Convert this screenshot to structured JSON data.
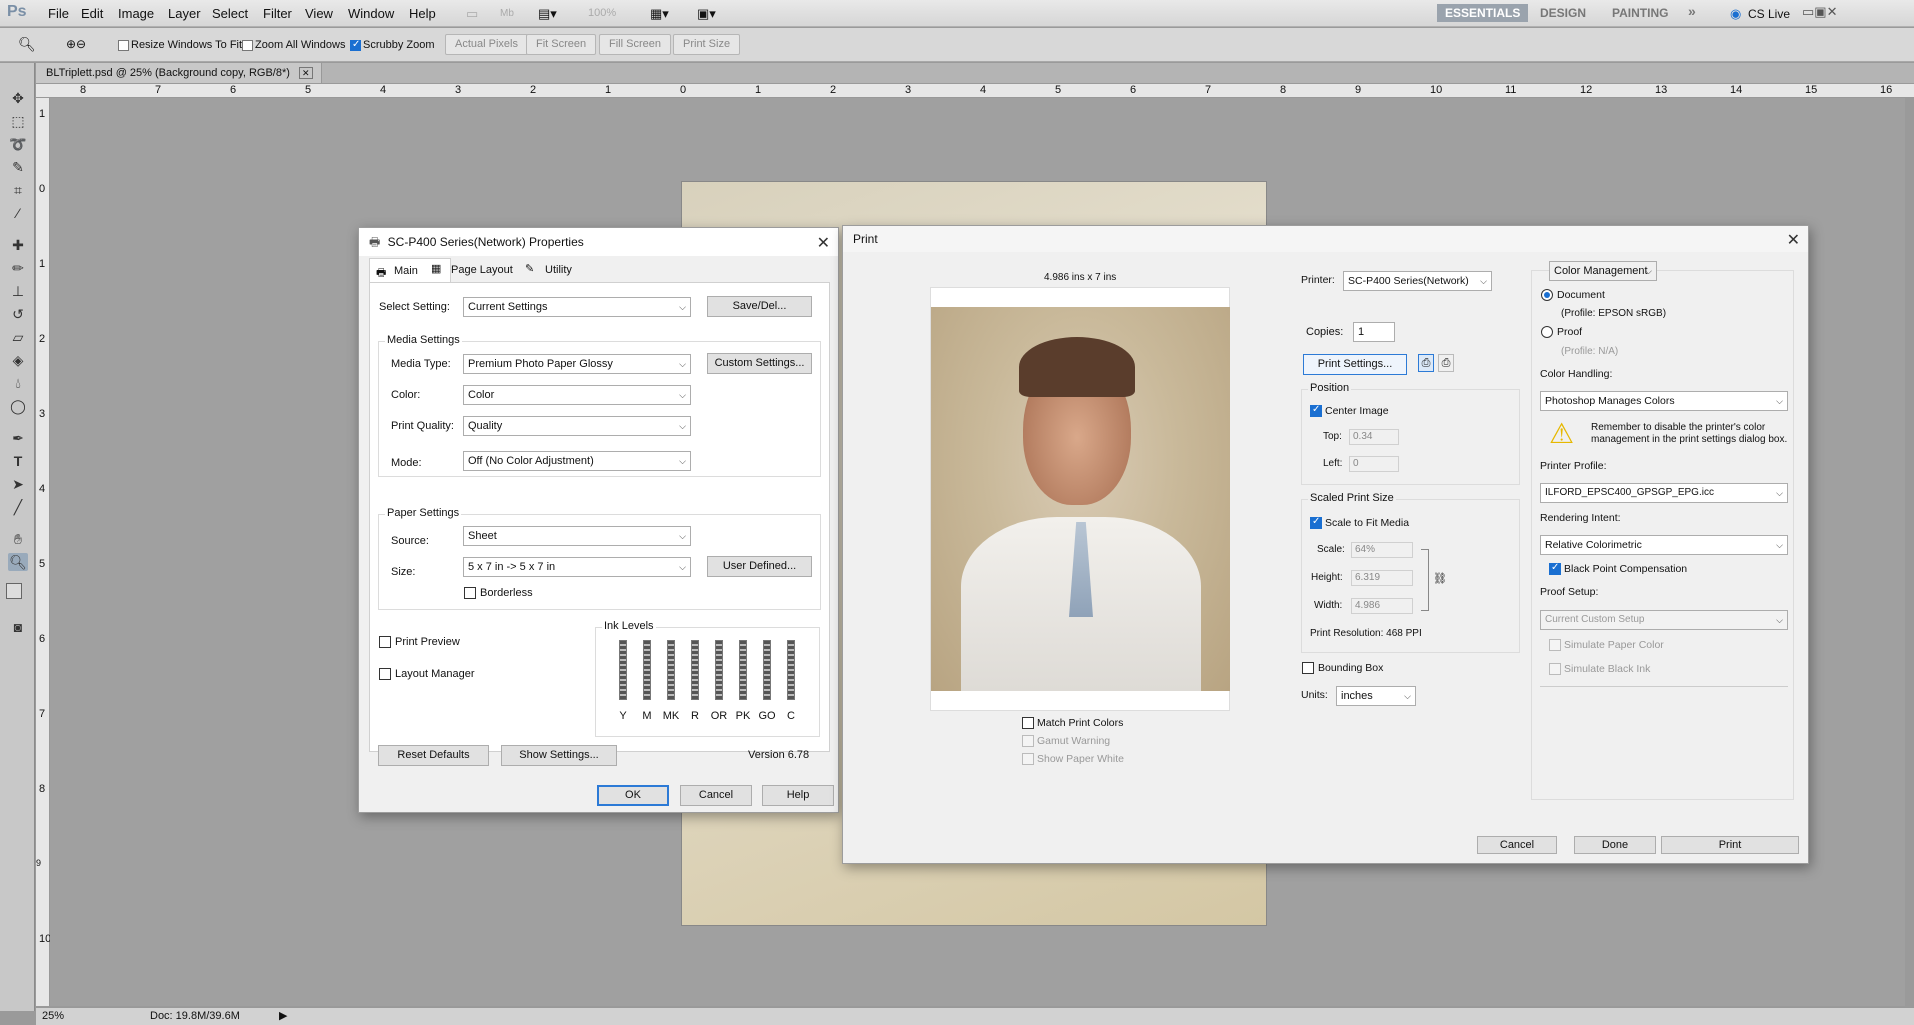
{
  "app": {
    "logo": "Ps",
    "menu": [
      "File",
      "Edit",
      "Image",
      "Layer",
      "Select",
      "Filter",
      "View",
      "Window",
      "Help"
    ],
    "zoom_readout": "100%",
    "workspaces": [
      "ESSENTIALS",
      "DESIGN",
      "PAINTING"
    ],
    "more_workspaces": "»",
    "cs_live": "CS Live"
  },
  "options_bar": {
    "resize_windows": "Resize Windows To Fit",
    "zoom_all": "Zoom All Windows",
    "scrubby_zoom": "Scrubby Zoom",
    "actual_pixels": "Actual Pixels",
    "fit_screen": "Fit Screen",
    "fill_screen": "Fill Screen",
    "print_size": "Print Size"
  },
  "document": {
    "tab_title": "BLTriplett.psd @ 25% (Background copy, RGB/8*)",
    "ruler_ticks_h": [
      "8",
      "7",
      "6",
      "5",
      "4",
      "3",
      "2",
      "1",
      "0",
      "1",
      "2",
      "3",
      "4",
      "5",
      "6",
      "7",
      "8",
      "9",
      "10",
      "11",
      "12",
      "13",
      "14",
      "15",
      "16"
    ],
    "ruler_ticks_v": [
      "1",
      "0",
      "1",
      "2",
      "3",
      "4",
      "5",
      "6",
      "7",
      "8",
      "9",
      "10"
    ],
    "status_zoom": "25%",
    "status_doc": "Doc: 19.8M/39.6M"
  },
  "driver_dialog": {
    "title": "SC-P400 Series(Network) Properties",
    "tabs": [
      "Main",
      "Page Layout",
      "Utility"
    ],
    "select_setting_label": "Select Setting:",
    "select_setting_value": "Current Settings",
    "save_del": "Save/Del...",
    "media_settings": "Media Settings",
    "media_type_label": "Media Type:",
    "media_type_value": "Premium Photo Paper Glossy",
    "custom_settings": "Custom Settings...",
    "color_label": "Color:",
    "color_value": "Color",
    "print_quality_label": "Print Quality:",
    "print_quality_value": "Quality",
    "mode_label": "Mode:",
    "mode_value": "Off (No Color Adjustment)",
    "paper_settings": "Paper Settings",
    "source_label": "Source:",
    "source_value": "Sheet",
    "size_label": "Size:",
    "size_value": "5 x 7 in -> 5 x 7 in",
    "user_defined": "User Defined...",
    "borderless": "Borderless",
    "print_preview": "Print Preview",
    "layout_manager": "Layout Manager",
    "ink_levels": "Ink Levels",
    "inks": [
      "Y",
      "M",
      "MK",
      "R",
      "OR",
      "PK",
      "GO",
      "C"
    ],
    "reset_defaults": "Reset Defaults",
    "show_settings": "Show Settings...",
    "version": "Version 6.78",
    "ok": "OK",
    "cancel": "Cancel",
    "help": "Help"
  },
  "print_dialog": {
    "title": "Print",
    "preview_size": "4.986 ins x 7 ins",
    "match_print_colors": "Match Print Colors",
    "gamut_warning": "Gamut Warning",
    "show_paper_white": "Show Paper White",
    "printer_label": "Printer:",
    "printer_value": "SC-P400 Series(Network)",
    "copies_label": "Copies:",
    "copies_value": "1",
    "print_settings": "Print Settings...",
    "position": "Position",
    "center_image": "Center Image",
    "top_label": "Top:",
    "top_value": "0.34",
    "left_label": "Left:",
    "left_value": "0",
    "scaled_print_size": "Scaled Print Size",
    "scale_to_fit": "Scale to Fit Media",
    "scale_label": "Scale:",
    "scale_value": "64%",
    "height_label": "Height:",
    "height_value": "6.319",
    "width_label": "Width:",
    "width_value": "4.986",
    "print_resolution": "Print Resolution: 468 PPI",
    "bounding_box": "Bounding Box",
    "units_label": "Units:",
    "units_value": "inches",
    "color_management": "Color Management",
    "document": "Document",
    "document_profile": "(Profile: EPSON  sRGB)",
    "proof": "Proof",
    "proof_profile": "(Profile: N/A)",
    "color_handling_label": "Color Handling:",
    "color_handling_value": "Photoshop Manages Colors",
    "warning_text": "Remember to disable the printer's color management in the print settings dialog box.",
    "printer_profile_label": "Printer Profile:",
    "printer_profile_value": "ILFORD_EPSC400_GPSGP_EPG.icc",
    "rendering_intent_label": "Rendering Intent:",
    "rendering_intent_value": "Relative Colorimetric",
    "black_point": "Black Point Compensation",
    "proof_setup_label": "Proof Setup:",
    "proof_setup_value": "Current Custom Setup",
    "simulate_paper": "Simulate Paper Color",
    "simulate_ink": "Simulate Black Ink",
    "cancel": "Cancel",
    "done": "Done",
    "print": "Print"
  }
}
